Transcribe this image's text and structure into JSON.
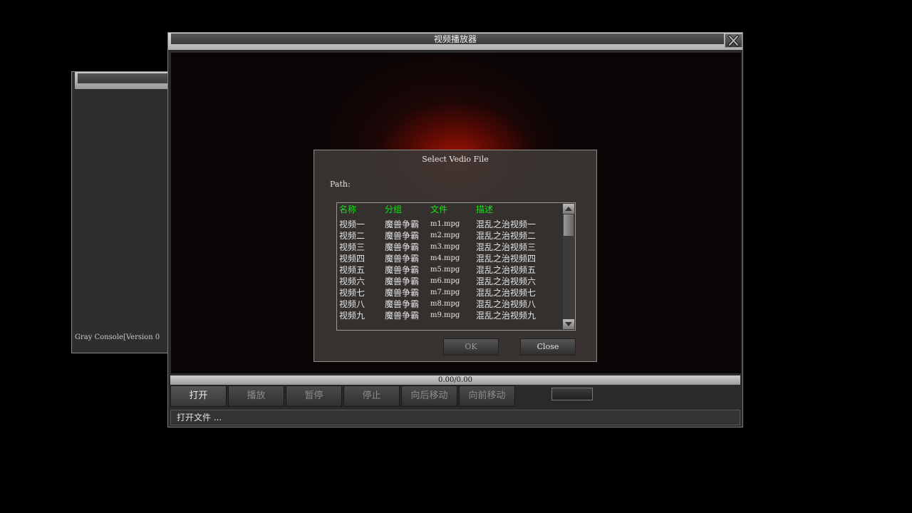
{
  "console": {
    "text": "Gray Console[Version 0"
  },
  "player": {
    "title": "视频播放器",
    "time": "0.00/0.00",
    "controls": [
      "打开",
      "播放",
      "暂停",
      "停止",
      "向后移动",
      "向前移动"
    ],
    "status": "打开文件 ..."
  },
  "dialog": {
    "title": "Select Vedio File",
    "path_label": "Path:",
    "columns": [
      "名称",
      "分组",
      "文件",
      "描述"
    ],
    "rows": [
      [
        "视频一",
        "魔兽争霸",
        "m1.mpg",
        "混乱之治视频一"
      ],
      [
        "视频二",
        "魔兽争霸",
        "m2.mpg",
        "混乱之治视频二"
      ],
      [
        "视频三",
        "魔兽争霸",
        "m3.mpg",
        "混乱之治视频三"
      ],
      [
        "视频四",
        "魔兽争霸",
        "m4.mpg",
        "混乱之治视频四"
      ],
      [
        "视频五",
        "魔兽争霸",
        "m5.mpg",
        "混乱之治视频五"
      ],
      [
        "视频六",
        "魔兽争霸",
        "m6.mpg",
        "混乱之治视频六"
      ],
      [
        "视频七",
        "魔兽争霸",
        "m7.mpg",
        "混乱之治视频七"
      ],
      [
        "视频八",
        "魔兽争霸",
        "m8.mpg",
        "混乱之治视频八"
      ],
      [
        "视频九",
        "魔兽争霸",
        "m9.mpg",
        "混乱之治视频九"
      ]
    ],
    "ok_label": "OK",
    "close_label": "Close"
  },
  "icons": {
    "close": "close-x-icon",
    "scroll_up": "arrow-up-icon",
    "scroll_down": "arrow-down-icon"
  },
  "colors": {
    "header_text": "#18e018",
    "accent_video": "#aa1400"
  }
}
